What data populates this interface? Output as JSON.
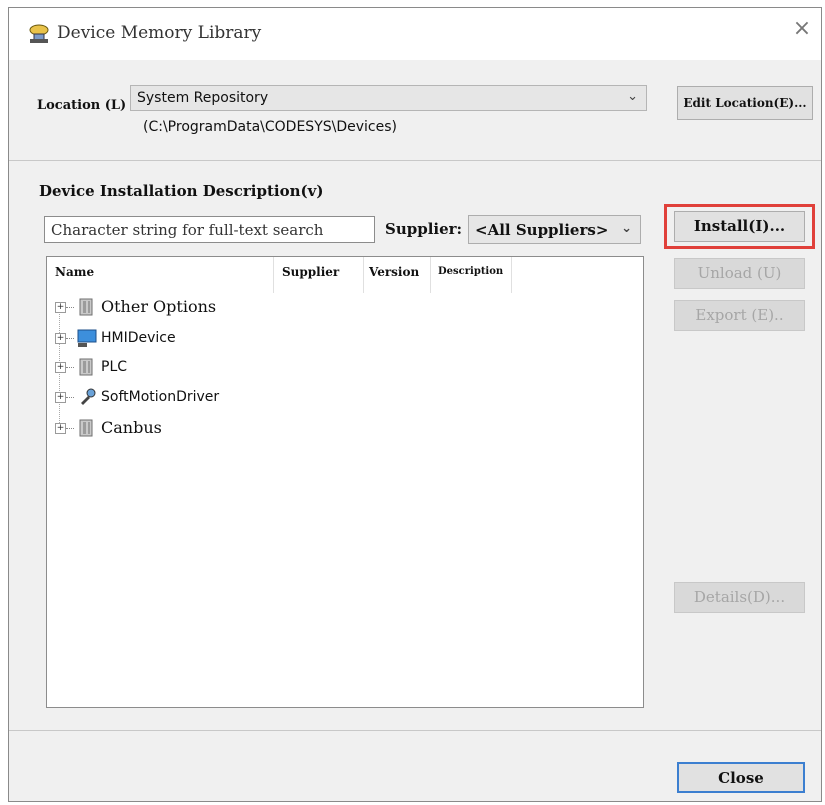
{
  "window": {
    "title": "Device Memory Library",
    "close_glyph": "×"
  },
  "location": {
    "label": "Location (L)",
    "selected": "System Repository",
    "path": "(C:\\ProgramData\\CODESYS\\Devices)",
    "edit_button": "Edit Location(E)..."
  },
  "devices": {
    "heading": "Device Installation Description(v)",
    "search_placeholder": "Character string for full-text search",
    "supplier_label": "Supplier:",
    "supplier_selected": "<All Suppliers>",
    "columns": [
      "Name",
      "Supplier",
      "Version",
      "Description"
    ],
    "tree": [
      {
        "label": "Other Options",
        "icon": "folder-icon"
      },
      {
        "label": "HMIDevice",
        "icon": "monitor-icon"
      },
      {
        "label": "PLC",
        "icon": "folder-icon"
      },
      {
        "label": "SoftMotionDriver",
        "icon": "wrench-icon"
      },
      {
        "label": "Canbus",
        "icon": "folder-icon"
      }
    ]
  },
  "buttons": {
    "install": "Install(I)...",
    "unload": "Unload (U)",
    "export": "Export (E)..",
    "details": "Details(D)...",
    "close": "Close"
  },
  "colors": {
    "highlight": "#e0403a",
    "default_button_border": "#3c7fd0"
  }
}
